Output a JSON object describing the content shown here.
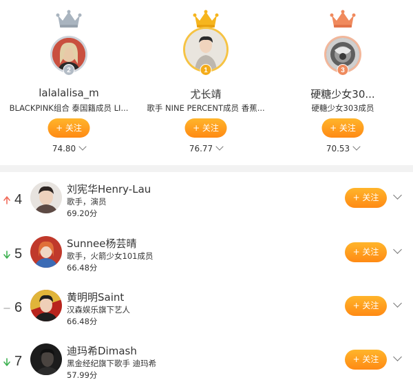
{
  "top3": [
    {
      "rank": "2",
      "name": "lalalalisa_m",
      "desc": "BLACKPINK组合 泰国籍成员 LI...",
      "follow_label": "+ 关注",
      "score": "74.80",
      "crown_color": "#a9b4bf",
      "badge_color": "#b3bcc6",
      "avatar_color": "#c9503f"
    },
    {
      "rank": "1",
      "name": "尤长靖",
      "desc": "歌手 NINE PERCENT成员 香蕉...",
      "follow_label": "+ 关注",
      "score": "76.77",
      "crown_color": "#f6b51e",
      "badge_color": "#f4ac1a",
      "avatar_color": "#d9d4cc"
    },
    {
      "rank": "3",
      "name": "硬糖少女30...",
      "desc": "硬糖少女303成员",
      "follow_label": "+ 关注",
      "score": "70.53",
      "crown_color": "#f08a5d",
      "badge_color": "#ef8b5e",
      "avatar_color": "#8a8a8a"
    }
  ],
  "list": [
    {
      "rank": "4",
      "trend": "up",
      "name": "刘宪华Henry-Lau",
      "desc": "歌手，演员",
      "score": "69.20分",
      "follow_label": "+ 关注",
      "avatar_color": "#5d4a44"
    },
    {
      "rank": "5",
      "trend": "down",
      "name": "Sunnee杨芸晴",
      "desc": "歌手，火箭少女101成员",
      "score": "66.48分",
      "follow_label": "+ 关注",
      "avatar_color": "#c0392b"
    },
    {
      "rank": "6",
      "trend": "flat",
      "name": "黄明明Saint",
      "desc": "汉森娱乐旗下艺人",
      "score": "66.48分",
      "follow_label": "+ 关注",
      "avatar_color": "#b8241d"
    },
    {
      "rank": "7",
      "trend": "down",
      "name": "迪玛希Dimash",
      "desc": "黑金经纪旗下歌手 迪玛希",
      "score": "57.99分",
      "follow_label": "+ 关注",
      "avatar_color": "#2b2b2b"
    }
  ],
  "colors": {
    "accent": "#ff9a1f",
    "trend_up": "#f06b5a",
    "trend_down": "#3cb050",
    "trend_flat": "#b8b8b8"
  }
}
